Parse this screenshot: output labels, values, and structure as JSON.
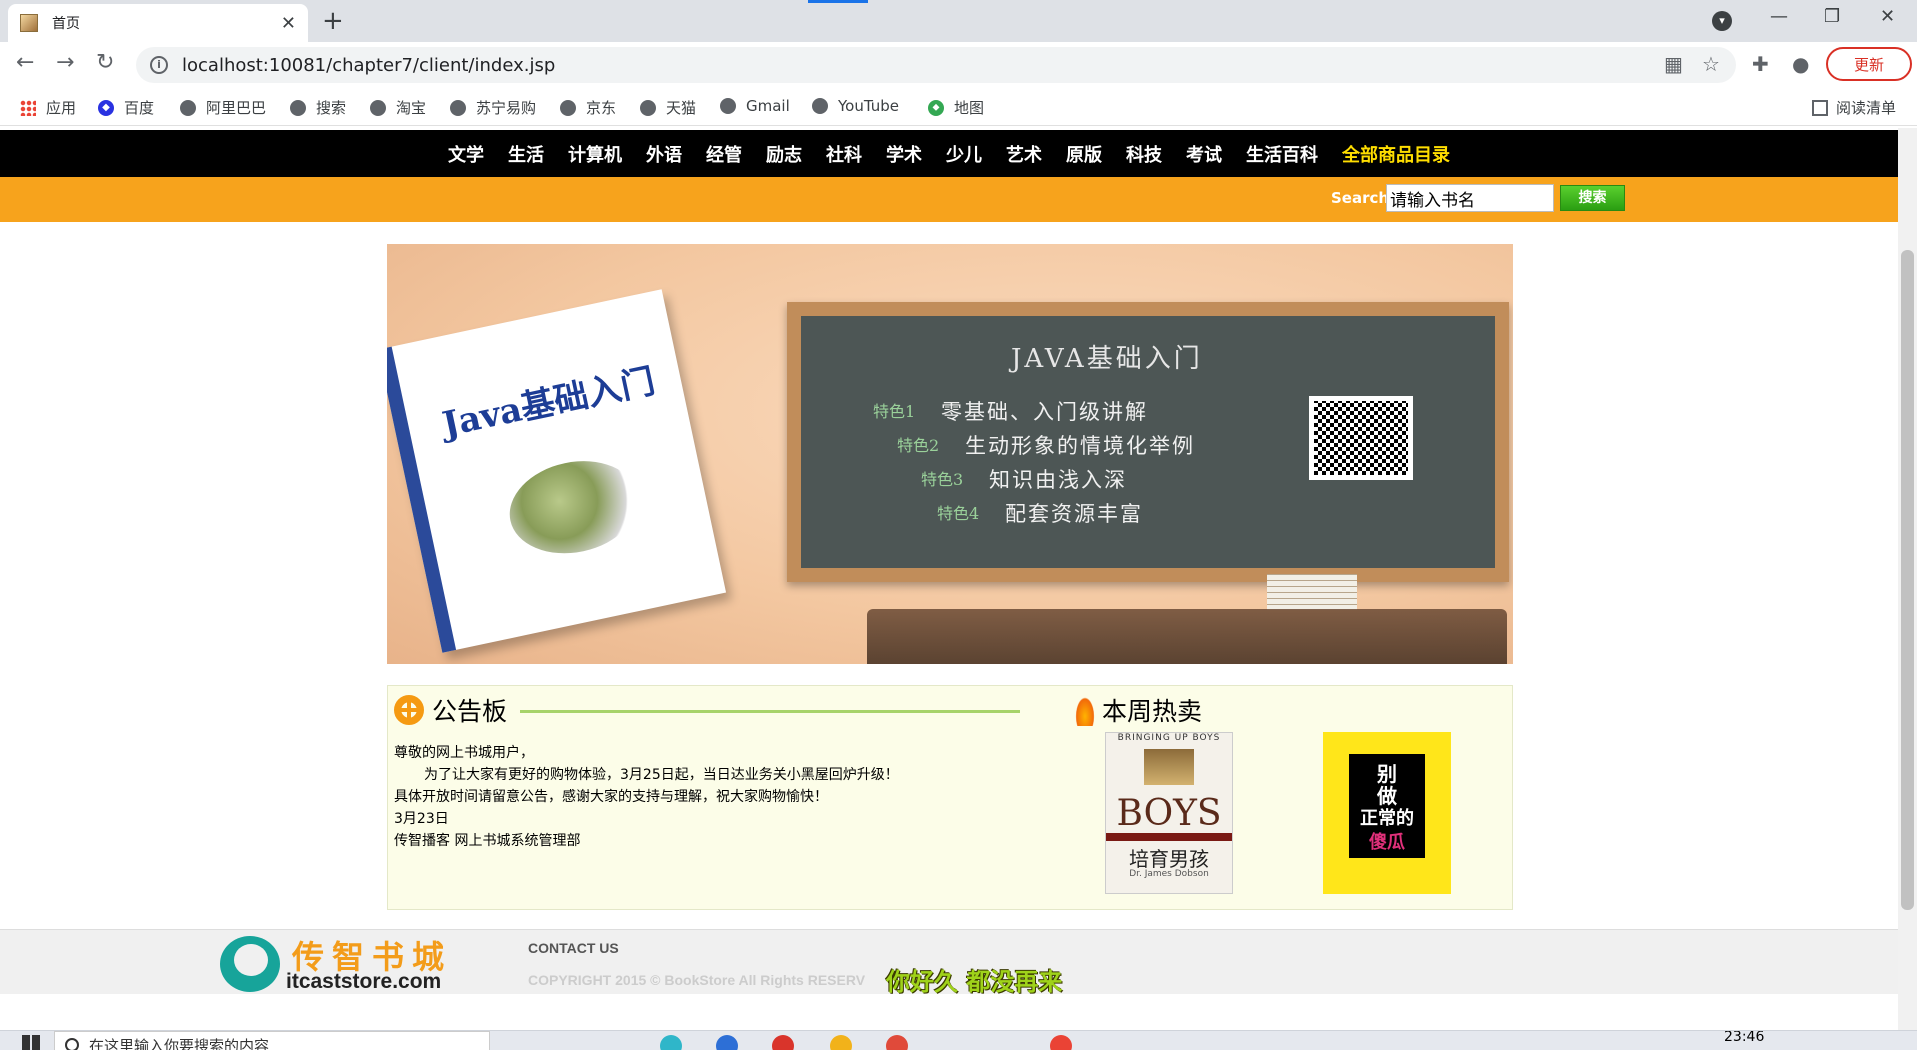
{
  "browser": {
    "tab_title": "首页",
    "url": "localhost:10081/chapter7/client/index.jsp",
    "update_label": "更新",
    "reading_list": "阅读清单",
    "bookmarks": [
      "应用",
      "百度",
      "阿里巴巴",
      "搜索",
      "淘宝",
      "苏宁易购",
      "京东",
      "天猫",
      "Gmail",
      "YouTube",
      "地图"
    ]
  },
  "site": {
    "categories": [
      "文学",
      "生活",
      "计算机",
      "外语",
      "经管",
      "励志",
      "社科",
      "学术",
      "少儿",
      "艺术",
      "原版",
      "科技",
      "考试",
      "生活百科"
    ],
    "all_categories": "全部商品目录",
    "search": {
      "label": "Search",
      "value": "请输入书名",
      "button": "搜索"
    },
    "banner": {
      "book_title": "Java基础入门",
      "board_title": "JAVA基础入门",
      "features": [
        {
          "tag": "特色1",
          "text": "零基础、入门级讲解"
        },
        {
          "tag": "特色2",
          "text": "生动形象的情境化举例"
        },
        {
          "tag": "特色3",
          "text": "知识由浅入深"
        },
        {
          "tag": "特色4",
          "text": "配套资源丰富"
        }
      ]
    },
    "notice": {
      "title": "公告板",
      "greeting": "尊敬的网上书城用户，",
      "line1": "为了让大家有更好的购物体验，3月25日起，当日达业务关小黑屋回炉升级！",
      "line2": "具体开放时间请留意公告，感谢大家的支持与理解，祝大家购物愉快！",
      "date": "3月23日",
      "signature": "传智播客 网上书城系统管理部"
    },
    "hot": {
      "title": "本周热卖",
      "books": [
        {
          "top": "BRINGING UP BOYS",
          "big": "BOYS",
          "cn": "培育男孩",
          "author": "Dr. James Dobson"
        },
        {
          "lines": [
            "别",
            "做",
            "正常的",
            "傻瓜"
          ]
        }
      ]
    },
    "footer": {
      "logo_cn": "传智书城",
      "logo_en": "itcaststore.com",
      "contact": "CONTACT US",
      "copyright": "COPYRIGHT 2015 © BookStore All Rights RESERV",
      "overlay": "你好久 都没再来"
    }
  },
  "taskbar": {
    "search_placeholder": "在这里输入你要搜索的内容",
    "time": "23:46"
  }
}
